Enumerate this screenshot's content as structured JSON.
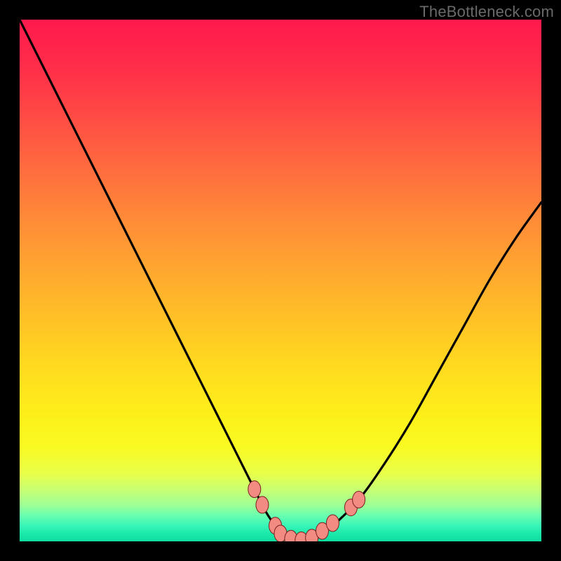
{
  "watermark": {
    "text": "TheBottleneck.com"
  },
  "colors": {
    "frame": "#000000",
    "curve": "#000000",
    "marker_fill": "#f28b82",
    "marker_stroke": "#7a1f1f",
    "gradient_top": "#ff1a4d",
    "gradient_bottom": "#10dca0"
  },
  "chart_data": {
    "type": "line",
    "title": "",
    "xlabel": "",
    "ylabel": "",
    "xlim": [
      0,
      100
    ],
    "ylim": [
      0,
      100
    ],
    "grid": false,
    "legend": false,
    "x": [
      0,
      5,
      10,
      15,
      20,
      25,
      30,
      35,
      40,
      45,
      47,
      49,
      51,
      53,
      55,
      57,
      60,
      65,
      70,
      75,
      80,
      85,
      90,
      95,
      100
    ],
    "values": [
      100,
      90,
      80,
      70,
      60,
      50,
      40,
      30,
      20,
      10,
      6,
      3,
      1,
      0,
      0,
      1,
      3,
      8,
      15,
      23,
      32,
      41,
      50,
      58,
      65
    ],
    "markers": [
      {
        "x": 45,
        "y": 10
      },
      {
        "x": 46.5,
        "y": 7
      },
      {
        "x": 49,
        "y": 3
      },
      {
        "x": 50,
        "y": 1.5
      },
      {
        "x": 52,
        "y": 0.5
      },
      {
        "x": 54,
        "y": 0.2
      },
      {
        "x": 56,
        "y": 0.7
      },
      {
        "x": 58,
        "y": 2
      },
      {
        "x": 60,
        "y": 3.5
      },
      {
        "x": 63.5,
        "y": 6.5
      },
      {
        "x": 65,
        "y": 8
      }
    ]
  }
}
